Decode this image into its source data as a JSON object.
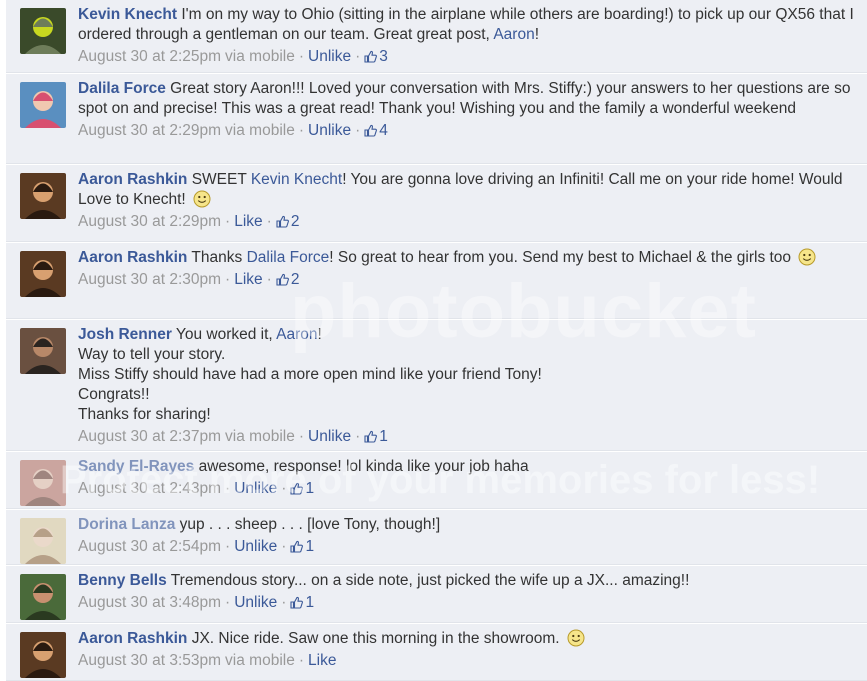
{
  "colors": {
    "link": "#3b5998",
    "meta": "#999999",
    "row_bg": "#edeff4",
    "text": "#333333"
  },
  "icons": {
    "like": "thumbs-up-icon",
    "emoticon": "smiley-icon"
  },
  "watermark": {
    "logo": "photobucket",
    "tagline": "Protect more of your memories for less!"
  },
  "comments": [
    {
      "author": "Kevin Knecht",
      "text_parts": [
        {
          "t": " I'm on my way to Ohio (sitting in the airplane while others are boarding!) to pick up our QX56 that I ordered through a gentleman on our team. Great great post, "
        },
        {
          "t": "Aaron",
          "link": true
        },
        {
          "t": "!"
        }
      ],
      "time": "August 30 at 2:25pm",
      "via": "via mobile",
      "action": "Unlike",
      "likes": "3",
      "avatar_palette": [
        "#3a4a2a",
        "#c8d820",
        "#6e7d5a"
      ]
    },
    {
      "author": "Dalila Force",
      "text_parts": [
        {
          "t": " Great story Aaron!!! Loved your conversation with Mrs. Stiffy:) your answers to her questions are so spot on and precise! This was a great read! Thank you! Wishing you and the family a wonderful weekend"
        }
      ],
      "time": "August 30 at 2:29pm",
      "via": "via mobile",
      "action": "Unlike",
      "likes": "4",
      "avatar_palette": [
        "#5a8fc0",
        "#f0c8b0",
        "#d85070"
      ]
    },
    {
      "author": "Aaron Rashkin",
      "text_parts": [
        {
          "t": " SWEET "
        },
        {
          "t": "Kevin Knecht",
          "link": true
        },
        {
          "t": "! You are gonna love driving an Infiniti! Call me on your ride home! Would Love to Knecht! "
        },
        {
          "emoticon": true
        }
      ],
      "time": "August 30 at 2:29pm",
      "via": "",
      "action": "Like",
      "likes": "2",
      "avatar_palette": [
        "#5a3a22",
        "#d8a070",
        "#2a1a10"
      ]
    },
    {
      "author": "Aaron Rashkin",
      "text_parts": [
        {
          "t": " Thanks "
        },
        {
          "t": "Dalila Force",
          "link": true
        },
        {
          "t": "! So great to hear from you. Send my best to Michael & the girls too "
        },
        {
          "emoticon": true
        }
      ],
      "time": "August 30 at 2:30pm",
      "via": "",
      "action": "Like",
      "likes": "2",
      "avatar_palette": [
        "#5a3a22",
        "#d8a070",
        "#2a1a10"
      ]
    },
    {
      "author": "Josh Renner",
      "text_parts": [
        {
          "t": " You worked it, "
        },
        {
          "t": "Aaron",
          "link": true
        },
        {
          "t": "!\nWay to tell your story.\nMiss Stiffy should have had a more open mind like your friend Tony!\nCongrats!!\nThanks for sharing!"
        }
      ],
      "time": "August 30 at 2:37pm",
      "via": "via mobile",
      "action": "Unlike",
      "likes": "1",
      "avatar_palette": [
        "#6a5040",
        "#b88868",
        "#2a2420"
      ]
    },
    {
      "author": "Sandy El-Rayes",
      "text_parts": [
        {
          "t": " awesome, response! lol kinda like your job haha"
        }
      ],
      "time": "August 30 at 2:43pm",
      "via": "",
      "action": "Unlike",
      "likes": "1",
      "avatar_palette": [
        "#b06a5a",
        "#e0b8a0",
        "#603020"
      ]
    },
    {
      "author": "Dorina Lanza",
      "text_parts": [
        {
          "t": " yup . . . sheep . . . [love Tony, though!]"
        }
      ],
      "time": "August 30 at 2:54pm",
      "via": "",
      "action": "Unlike",
      "likes": "1",
      "avatar_palette": [
        "#d8c898",
        "#e8c8a8",
        "#8a6030"
      ]
    },
    {
      "author": "Benny Bells",
      "text_parts": [
        {
          "t": " Tremendous story... on a side note, just picked the wife up a JX... amazing!!"
        }
      ],
      "time": "August 30 at 3:48pm",
      "via": "",
      "action": "Unlike",
      "likes": "1",
      "avatar_palette": [
        "#4a6a3a",
        "#c89070",
        "#2a3a20"
      ]
    },
    {
      "author": "Aaron Rashkin",
      "text_parts": [
        {
          "t": " JX. Nice ride. Saw one this morning in the showroom. "
        },
        {
          "emoticon": true
        }
      ],
      "time": "August 30 at 3:53pm",
      "via": "via mobile",
      "action": "Like",
      "likes": "",
      "avatar_palette": [
        "#5a3a22",
        "#d8a070",
        "#2a1a10"
      ]
    }
  ]
}
